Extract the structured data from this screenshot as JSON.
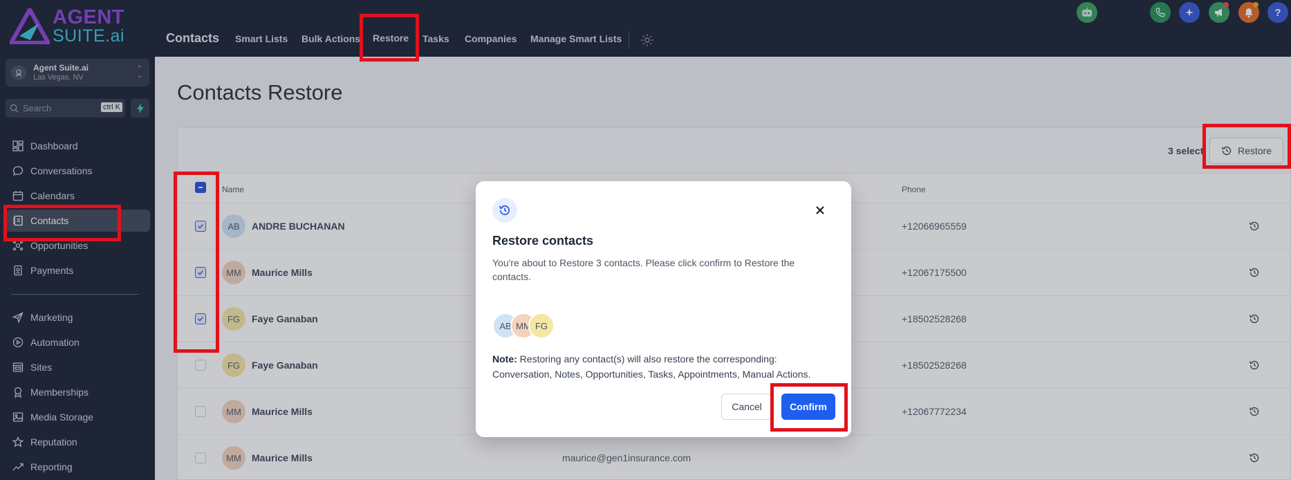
{
  "colors": {
    "sidebar_bg": "#131b2d",
    "accent_blue": "#1e5eef",
    "highlight_red": "#e0121c",
    "logo_purple": "#8b3fd9",
    "logo_cyan": "#36c5d8"
  },
  "logo": {
    "line1": "AGENT",
    "line2": "SUITE.ai"
  },
  "location": {
    "name": "Agent Suite.ai",
    "city": "Las Vegas, NV"
  },
  "search": {
    "placeholder": "Search",
    "shortcut": "ctrl K"
  },
  "sidebar": {
    "items": [
      {
        "label": "Dashboard",
        "icon": "dashboard-icon"
      },
      {
        "label": "Conversations",
        "icon": "chat-icon"
      },
      {
        "label": "Calendars",
        "icon": "calendar-icon"
      },
      {
        "label": "Contacts",
        "icon": "contacts-icon",
        "active": true
      },
      {
        "label": "Opportunities",
        "icon": "opportunities-icon"
      },
      {
        "label": "Payments",
        "icon": "payments-icon"
      },
      {
        "label": "Marketing",
        "icon": "send-icon"
      },
      {
        "label": "Automation",
        "icon": "automation-icon"
      },
      {
        "label": "Sites",
        "icon": "sites-icon"
      },
      {
        "label": "Memberships",
        "icon": "memberships-icon"
      },
      {
        "label": "Media Storage",
        "icon": "media-icon"
      },
      {
        "label": "Reputation",
        "icon": "star-icon"
      },
      {
        "label": "Reporting",
        "icon": "chart-line-icon"
      }
    ]
  },
  "topbar": {
    "title": "Contacts",
    "links": [
      "Smart Lists",
      "Bulk Actions",
      "Restore",
      "Tasks",
      "Companies",
      "Manage Smart Lists"
    ],
    "icons": [
      "bot-icon",
      "phone-icon",
      "sparkle-icon",
      "megaphone-icon",
      "bell-icon",
      "help-icon"
    ]
  },
  "page": {
    "title": "Contacts Restore",
    "selected_text": "3 select",
    "restore_button": "Restore",
    "columns": {
      "name": "Name",
      "phone": "Phone"
    }
  },
  "rows": [
    {
      "initials": "AB",
      "name": "ANDRE BUCHANAN",
      "phone": "+12066965559",
      "email": "",
      "checked": true
    },
    {
      "initials": "MM",
      "name": "Maurice Mills",
      "phone": "+12067175500",
      "email": "",
      "checked": true
    },
    {
      "initials": "FG",
      "name": "Faye Ganaban",
      "phone": "+18502528268",
      "email": "",
      "checked": true
    },
    {
      "initials": "FG",
      "name": "Faye Ganaban",
      "phone": "+18502528268",
      "email": "",
      "checked": false
    },
    {
      "initials": "MM",
      "name": "Maurice Mills",
      "phone": "+12067772234",
      "email": "",
      "checked": false
    },
    {
      "initials": "MM",
      "name": "Maurice Mills",
      "phone": "",
      "email": "maurice@gen1insurance.com",
      "checked": false
    }
  ],
  "modal": {
    "title": "Restore contacts",
    "description": "You're about to Restore 3 contacts. Please click confirm to Restore the contacts.",
    "avatars": [
      "AB",
      "MM",
      "FG"
    ],
    "note_label": "Note:",
    "note_text": " Restoring any contact(s) will also restore the corresponding: Conversation, Notes, Opportunities, Tasks, Appointments, Manual Actions.",
    "cancel": "Cancel",
    "confirm": "Confirm"
  }
}
